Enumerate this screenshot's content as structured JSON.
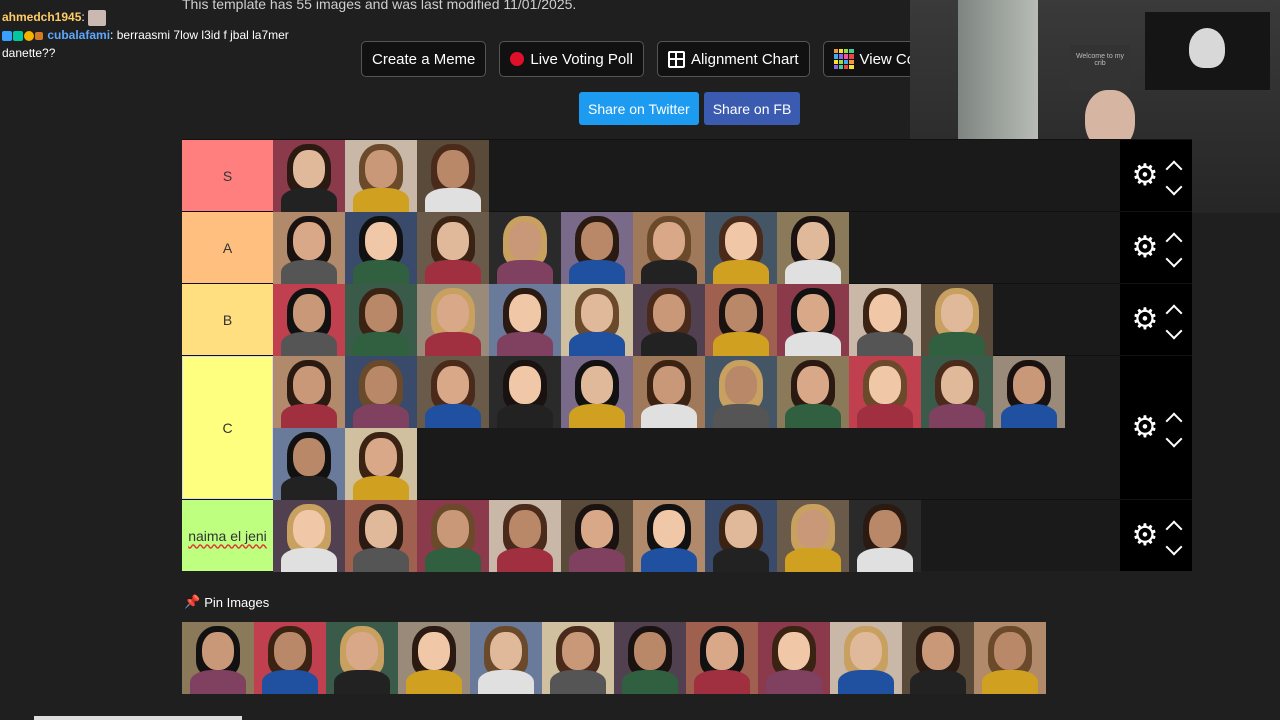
{
  "chat": {
    "user1": "ahmedch1945",
    "sep1": ":",
    "user2": "cubalafami",
    "sep2": ":",
    "message2": "berraasmi 7low l3id f jbal la7mer danette??"
  },
  "subtitle": "This template has 55 images and was last modified 11/01/2025.",
  "buttons": {
    "create_meme": "Create a Meme",
    "live_poll": "Live Voting Poll",
    "alignment_chart": "Alignment Chart",
    "view_co": "View Co"
  },
  "share": {
    "twitter": "Share on Twitter",
    "fb": "Share on FB"
  },
  "webcam": {
    "poster_text": "Welcome to my crib"
  },
  "tiers": [
    {
      "label": "S",
      "color": "#ff7f7f",
      "count": 3
    },
    {
      "label": "A",
      "color": "#ffbf7f",
      "count": 8
    },
    {
      "label": "B",
      "color": "#ffdf7f",
      "count": 10
    },
    {
      "label": "C",
      "color": "#ffff7f",
      "count": 13
    },
    {
      "label": "naima el jeni",
      "color": "#bfff7f",
      "count": 9
    }
  ],
  "pin": {
    "title": "Pin Images",
    "count": 12
  },
  "colors": {
    "background": "#1f1f1f",
    "twitter": "#1d9bf0",
    "facebook": "#3b5bb1",
    "live_dot": "#e0102a"
  }
}
